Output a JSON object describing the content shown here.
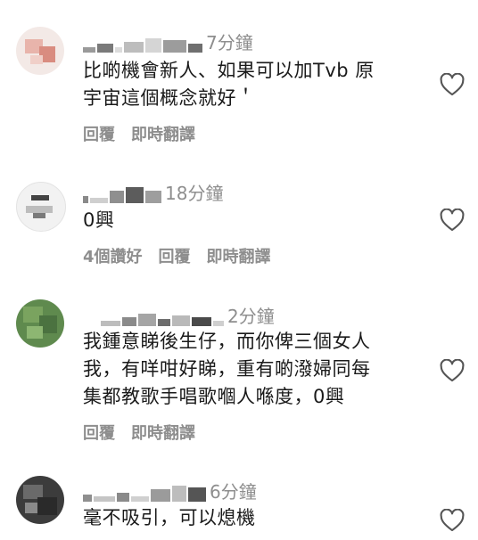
{
  "comments": [
    {
      "time": "7分鐘",
      "lines": [
        "比啲機會新人、如果可以加Tvb 原",
        "宇宙這個概念就好＇"
      ],
      "actions": [
        "回覆",
        "即時翻譯"
      ]
    },
    {
      "time": "18分鐘",
      "lines": [
        "0興"
      ],
      "actions": [
        "4個讚好",
        "回覆",
        "即時翻譯"
      ]
    },
    {
      "time": "2分鐘",
      "lines": [
        "我鍾意睇後生仔，而你俾三個女人",
        "我，有咩咁好睇，重有啲潑婦同每",
        "集都教歌手唱歌嗰人喺度，0興"
      ],
      "actions": [
        "回覆",
        "即時翻譯"
      ]
    },
    {
      "time": "6分鐘",
      "lines": [
        "毫不吸引，可以熄機"
      ],
      "actions": []
    }
  ],
  "colors": {
    "text": "#1a1a1a",
    "secondary": "#8e8e8e",
    "background": "#ffffff"
  },
  "icons": [
    "like-heart-icon"
  ]
}
